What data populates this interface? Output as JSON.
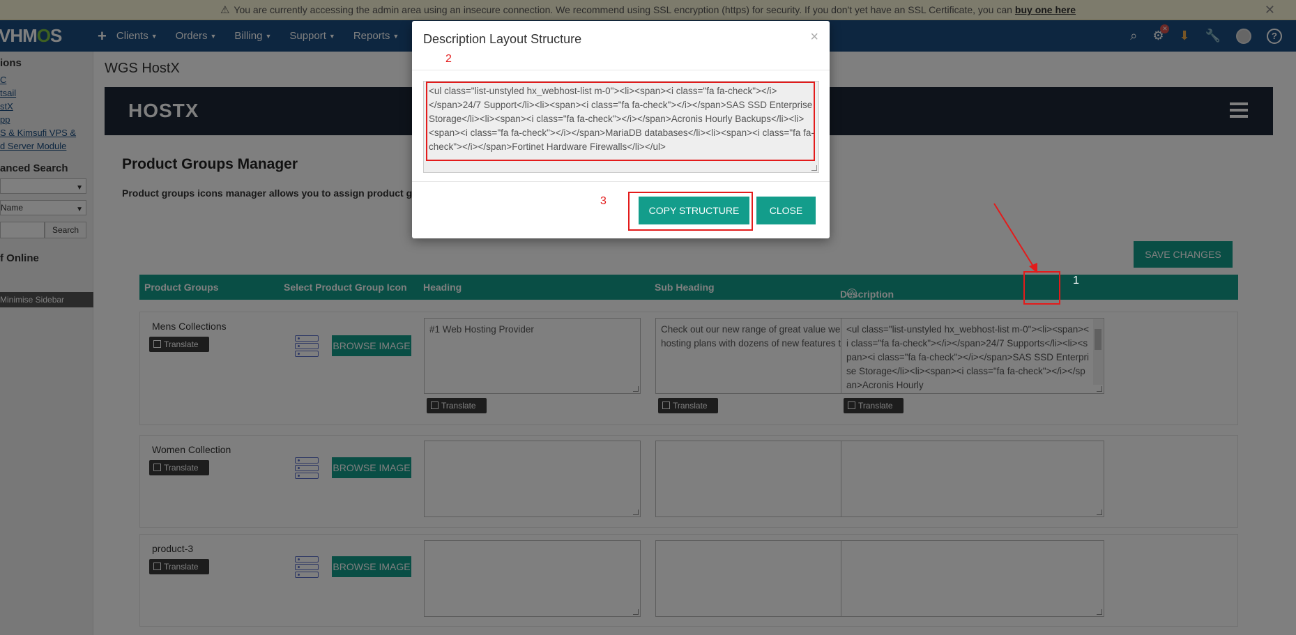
{
  "warning": {
    "text": "You are currently accessing the admin area using an insecure connection. We recommend using SSL encryption (https) for security. If you don't yet have an SSL Certificate, you can",
    "link": "buy one here"
  },
  "nav": {
    "logo_a": "VHM",
    "logo_b": "O",
    "logo_c": "S",
    "items": [
      "Clients",
      "Orders",
      "Billing",
      "Support",
      "Reports"
    ],
    "notification_count": "✕"
  },
  "sidebar": {
    "sections_head": "ions",
    "links": [
      "C",
      "tsail",
      "stX",
      "pp",
      "S & Kimsufi VPS &",
      "d Server Module"
    ],
    "adv_search_head": "anced Search",
    "select2": "Name",
    "search_btn": "Search",
    "staff_head": "f Online",
    "minimise": "Minimise Sidebar"
  },
  "main": {
    "page_title": "WGS HostX",
    "brand": "HOSTX",
    "section_title": "Product Groups Manager",
    "section_desc": "Product groups icons manager allows you to assign product g",
    "save_btn": "SAVE CHANGES",
    "columns": [
      "Product Groups",
      "Select Product Group Icon",
      "Heading",
      "Sub Heading",
      "Description"
    ],
    "translate": "Translate",
    "browse": "BROWSE IMAGE",
    "rows": [
      {
        "name": "Mens Collections",
        "heading": "#1 Web Hosting Provider",
        "subheading": "Check out our new range of great value web hosting plans with dozens of new features test.",
        "description": "<ul class=\"list-unstyled hx_webhost-list m-0\"><li><span><i class=\"fa fa-check\"></i></span>24/7 Supports</li><li><span><i class=\"fa fa-check\"></i></span>SAS SSD Enterprise Storage</li><li><span><i class=\"fa fa-check\"></i></span>Acronis Hourly"
      },
      {
        "name": "Women Collection",
        "heading": "",
        "subheading": "",
        "description": ""
      },
      {
        "name": "product-3",
        "heading": "",
        "subheading": "",
        "description": ""
      }
    ]
  },
  "modal": {
    "title": "Description Layout Structure",
    "content": "<ul class=\"list-unstyled hx_webhost-list m-0\"><li><span><i class=\"fa fa-check\"></i></span>24/7 Support</li><li><span><i class=\"fa fa-check\"></i></span>SAS SSD Enterprise Storage</li><li><span><i class=\"fa fa-check\"></i></span>Acronis Hourly Backups</li><li><span><i class=\"fa fa-check\"></i></span>MariaDB databases</li><li><span><i class=\"fa fa-check\"></i></span>Fortinet Hardware Firewalls</li></ul>",
    "copy_btn": "COPY STRUCTURE",
    "close_btn": "CLOSE"
  },
  "annotations": {
    "n1": "1",
    "n2": "2",
    "n3": "3"
  },
  "colors": {
    "teal": "#139d8b",
    "navbar": "#1a4d80",
    "annotation_red": "#e31b1b"
  }
}
